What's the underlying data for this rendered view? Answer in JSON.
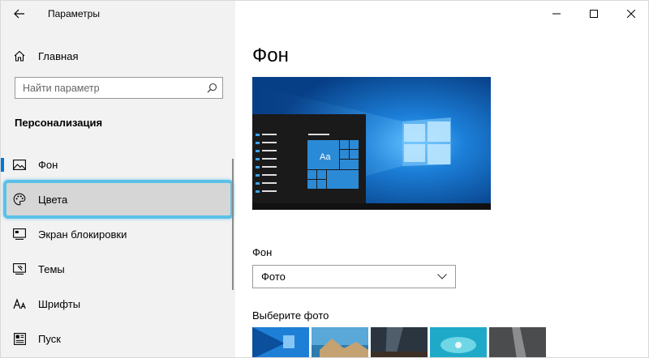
{
  "window": {
    "title": "Параметры"
  },
  "sidebar": {
    "home_label": "Главная",
    "search_placeholder": "Найти параметр",
    "section_title": "Персонализация",
    "items": [
      {
        "label": "Фон",
        "icon": "image-icon",
        "active": true
      },
      {
        "label": "Цвета",
        "icon": "palette-icon",
        "highlighted": true
      },
      {
        "label": "Экран блокировки",
        "icon": "lock-screen-icon"
      },
      {
        "label": "Темы",
        "icon": "themes-icon"
      },
      {
        "label": "Шрифты",
        "icon": "fonts-icon"
      },
      {
        "label": "Пуск",
        "icon": "start-icon"
      }
    ]
  },
  "main": {
    "page_title": "Фон",
    "preview_tile_text": "Aa",
    "background_label": "Фон",
    "background_value": "Фото",
    "choose_photo_label": "Выберите фото"
  },
  "colors": {
    "accent": "#0078d7",
    "highlight": "#5bc0e8",
    "sidebar_bg": "#f2f2f2"
  }
}
